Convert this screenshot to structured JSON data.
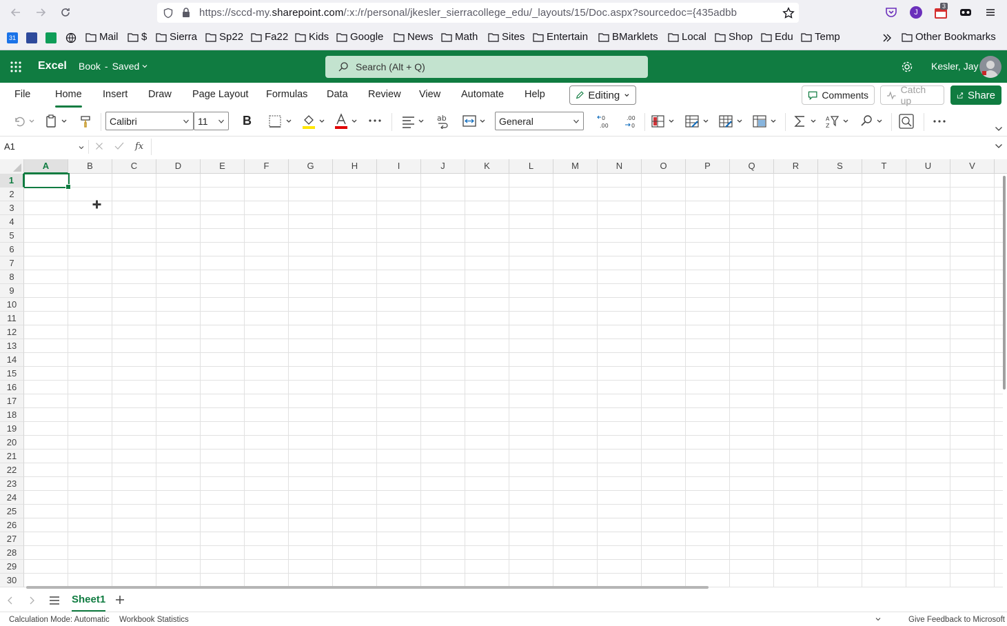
{
  "browser": {
    "url_prefix": "https://sccd-my.",
    "url_host": "sharepoint.com",
    "url_rest": "/:x:/r/personal/jkesler_sierracollege_edu/_layouts/15/Doc.aspx?sourcedoc={435adbb",
    "extension_badge": "3",
    "account_initial": "J"
  },
  "bookmarks": [
    "Mail",
    "$",
    "Sierra",
    "Sp22",
    "Fa22",
    "Kids",
    "Google",
    "News",
    "Math",
    "Sites",
    "Entertain",
    "BMarklets",
    "Local",
    "Shop",
    "Edu",
    "Temp"
  ],
  "other_bookmarks": "Other Bookmarks",
  "app": {
    "name": "Excel",
    "doc_name": "Book",
    "doc_separator": "-",
    "doc_status": "Saved",
    "search_placeholder": "Search (Alt + Q)",
    "user_name": "Kesler, Jay"
  },
  "ribbon": {
    "tabs": [
      "File",
      "Home",
      "Insert",
      "Draw",
      "Page Layout",
      "Formulas",
      "Data",
      "Review",
      "View",
      "Automate",
      "Help"
    ],
    "active_tab": "Home",
    "mode_label": "Editing",
    "comments_label": "Comments",
    "catchup_label": "Catch up",
    "share_label": "Share"
  },
  "toolbar": {
    "font_name": "Calibri",
    "font_size": "11",
    "bold_label": "B",
    "number_format": "General",
    "font_color": "#e00000",
    "highlight_color": "#ffe600"
  },
  "formula_bar": {
    "name_box": "A1",
    "fx_label": "fx",
    "formula": ""
  },
  "grid": {
    "columns": [
      "A",
      "B",
      "C",
      "D",
      "E",
      "F",
      "G",
      "H",
      "I",
      "J",
      "K",
      "L",
      "M",
      "N",
      "O",
      "P",
      "Q",
      "R",
      "S",
      "T",
      "U",
      "V"
    ],
    "rows": [
      "1",
      "2",
      "3",
      "4",
      "5",
      "6",
      "7",
      "8",
      "9",
      "10",
      "11",
      "12",
      "13",
      "14",
      "15",
      "16",
      "17",
      "18",
      "19",
      "20",
      "21",
      "22",
      "23",
      "24",
      "25",
      "26",
      "27",
      "28",
      "29",
      "30"
    ],
    "selected_cell": "A1"
  },
  "sheets": {
    "active": "Sheet1"
  },
  "status": {
    "calc_mode": "Calculation Mode: Automatic",
    "workbook_stats": "Workbook Statistics",
    "feedback": "Give Feedback to Microsoft"
  },
  "colors": {
    "brand": "#107c41",
    "search_bg": "#c3e3cf"
  }
}
